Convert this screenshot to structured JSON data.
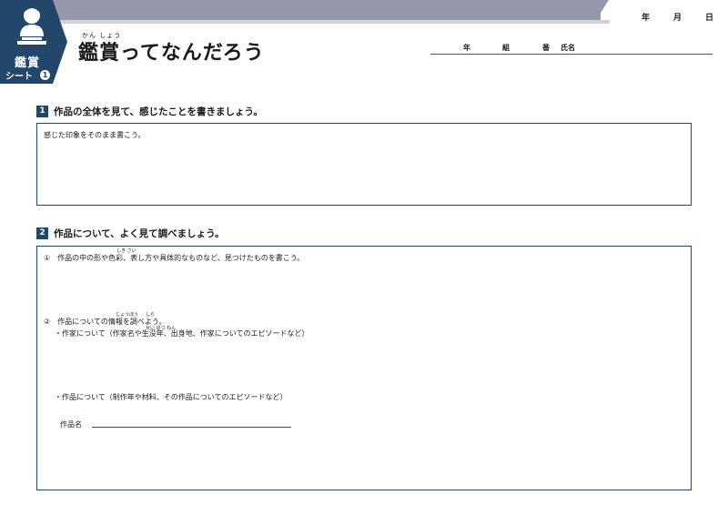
{
  "header": {
    "badge_title": "鑑賞",
    "badge_sub": "シート",
    "badge_num": "1",
    "title_ruby": "かん しょう",
    "title": "鑑賞ってなんだろう",
    "date_labels": [
      "年",
      "月",
      "日"
    ],
    "name_labels": [
      "年",
      "組",
      "番",
      "氏名"
    ]
  },
  "sections": [
    {
      "num": "1",
      "heading": "作品の全体を見て、感じたことを書きましょう。",
      "prompt": "感じた印象をそのまま書こう。"
    },
    {
      "num": "2",
      "heading": "作品について、よく見て調べましょう。",
      "item1": "①　作品の中の形や色彩、表し方や具体的なものなど、見つけたものを書こう。",
      "item1_ruby": "しき さい",
      "item2": "②　作品についての情報を調べよう。",
      "item2_ruby1": "じょうほう",
      "item2_ruby2": "しら",
      "sub1": "・作家について（作家名や生没年、出身地、作家についてのエピソードなど）",
      "sub1_ruby": "せい ぼつ ねん",
      "sub2": "・作品について（制作年や材料、その作品についてのエピソードなど）",
      "artwork_label": "作品名"
    }
  ],
  "colors": {
    "accent": "#23476a",
    "band": "#9597ab"
  },
  "icons": {
    "badge_figure": "bust-statue-icon"
  }
}
